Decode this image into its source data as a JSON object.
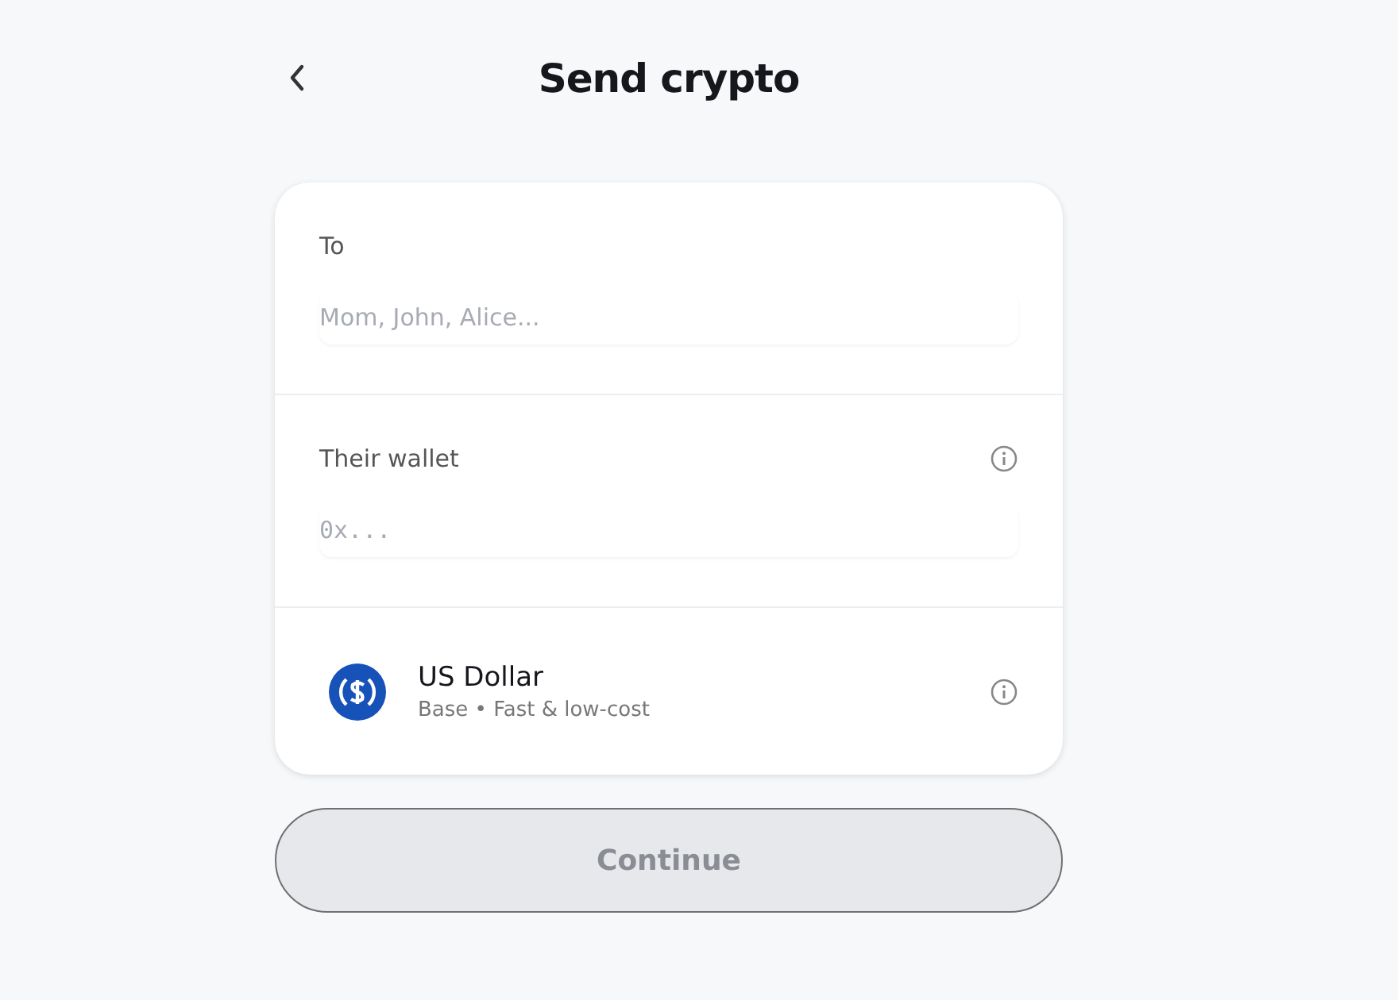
{
  "header": {
    "title": "Send crypto"
  },
  "recipient": {
    "label": "To",
    "placeholder": "Mom, John, Alice..."
  },
  "wallet": {
    "label": "Their wallet",
    "placeholder": "0x...",
    "info": true
  },
  "asset": {
    "name": "US Dollar",
    "detail": "Base • Fast & low-cost",
    "info": true
  },
  "continue_button": {
    "label": "Continue",
    "disabled": true
  }
}
